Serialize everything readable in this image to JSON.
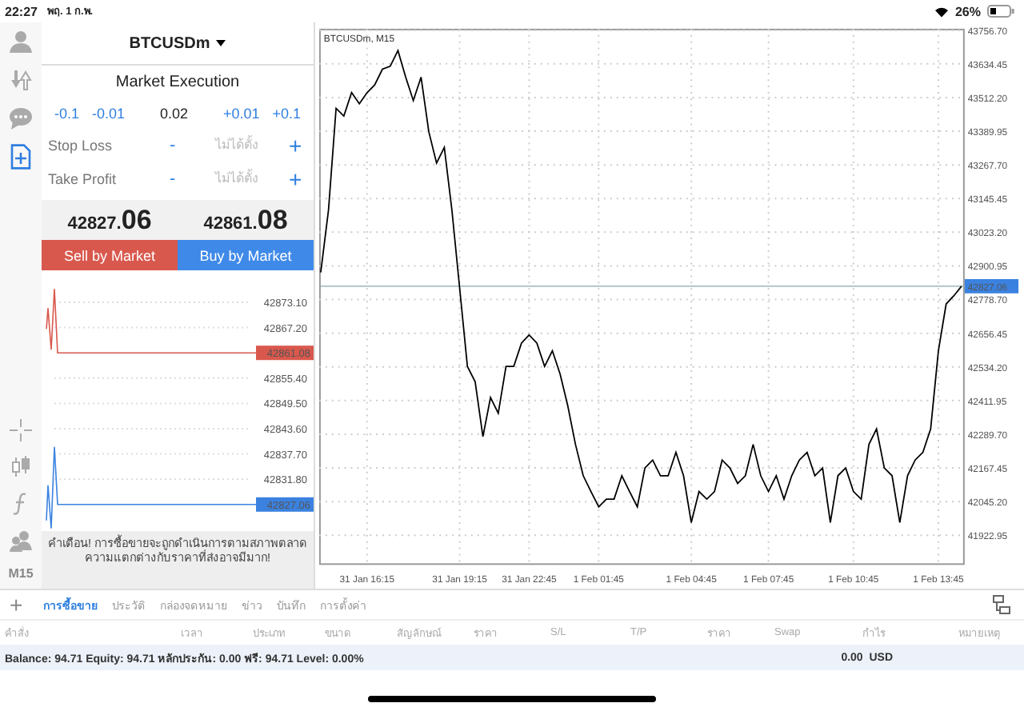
{
  "status_bar": {
    "time": "22:27",
    "date": "พฤ. 1 ก.พ.",
    "battery": "26%"
  },
  "toolbar": {
    "top": [
      {
        "kind": "account",
        "selected": false
      },
      {
        "kind": "trade",
        "selected": false
      },
      {
        "kind": "chat",
        "selected": false
      },
      {
        "kind": "new-order",
        "selected": true
      }
    ],
    "bottom": [
      {
        "kind": "crosshair",
        "selected": false
      },
      {
        "kind": "candles",
        "selected": false
      },
      {
        "kind": "function",
        "selected": false
      },
      {
        "kind": "people",
        "selected": false
      }
    ],
    "timeframe": "M15"
  },
  "order": {
    "symbol": "BTCUSDm",
    "mode": "Market Execution",
    "volume_steps": [
      "-0.1",
      "-0.01",
      "+0.01",
      "+0.1"
    ],
    "volume": "0.02",
    "levels": [
      {
        "label": "Stop Loss",
        "minus": "-",
        "placeholder": "ไม่ได้ตั้ง",
        "plus": "+"
      },
      {
        "label": "Take Profit",
        "minus": "-",
        "placeholder": "ไม่ได้ตั้ง",
        "plus": "+"
      }
    ],
    "bid": {
      "main": "42827.",
      "pips": "06"
    },
    "ask": {
      "main": "42861.",
      "pips": "08"
    },
    "sell_button": "Sell by Market",
    "buy_button": "Buy by Market",
    "tick_chart": {
      "rows": [
        {
          "kind": "tick",
          "label": "42873.10"
        },
        {
          "kind": "tick",
          "label": "42867.20"
        },
        {
          "kind": "ask",
          "label": "42861.08"
        },
        {
          "kind": "tick",
          "label": "42855.40"
        },
        {
          "kind": "tick",
          "label": "42849.50"
        },
        {
          "kind": "tick",
          "label": "42843.60"
        },
        {
          "kind": "tick",
          "label": "42837.70"
        },
        {
          "kind": "tick",
          "label": "42831.80"
        },
        {
          "kind": "bid",
          "label": "42827.06"
        }
      ]
    },
    "warning": "คำเตือน! การซื้อขายจะถูกดำเนินการตามสภาพตลาด ความแตกต่างกับราคาที่ส่งอาจมีมาก!"
  },
  "chart": {
    "chart_data": {
      "type": "line",
      "title": "BTCUSDm, M15",
      "categories": [
        null,
        null,
        null,
        null,
        null,
        null,
        "31 Jan 16:15",
        null,
        null,
        null,
        null,
        null,
        null,
        null,
        null,
        null,
        null,
        null,
        "31 Jan 19:15",
        null,
        null,
        null,
        null,
        null,
        null,
        null,
        null,
        "31 Jan 22:45",
        null,
        null,
        null,
        null,
        null,
        null,
        null,
        null,
        "1 Feb 01:45",
        null,
        null,
        null,
        null,
        null,
        null,
        null,
        null,
        null,
        null,
        null,
        "1 Feb 04:45",
        null,
        null,
        null,
        null,
        null,
        null,
        null,
        null,
        null,
        "1 Feb 07:45",
        null,
        null,
        null,
        null,
        null,
        null,
        null,
        null,
        null,
        null,
        "1 Feb 10:45",
        null,
        null,
        null,
        null,
        null,
        null,
        null,
        null,
        null,
        null,
        "1 Feb 13:45",
        null,
        null,
        null
      ],
      "series": [
        {
          "color": "#000000",
          "values": [
            42877,
            43104,
            43473,
            43445,
            43530,
            43490,
            43530,
            43558,
            43615,
            43626,
            43683,
            43586,
            43501,
            43586,
            43388,
            43274,
            43331,
            43104,
            42820,
            42536,
            42480,
            42281,
            42423,
            42366,
            42536,
            42536,
            42621,
            42650,
            42621,
            42536,
            42593,
            42508,
            42394,
            42253,
            42139,
            42082,
            42026,
            42054,
            42054,
            42139,
            42082,
            42026,
            42167,
            42196,
            42139,
            42139,
            42224,
            42139,
            41969,
            42082,
            42054,
            42082,
            42196,
            42167,
            42111,
            42139,
            42253,
            42139,
            42082,
            42139,
            42054,
            42139,
            42196,
            42224,
            42139,
            42167,
            41969,
            42139,
            42167,
            42082,
            42054,
            42253,
            42309,
            42167,
            42139,
            41969,
            42139,
            42196,
            42224,
            42309,
            42593,
            42763,
            42792,
            42827
          ]
        }
      ],
      "ylim": [
        41821,
        43762
      ],
      "grid": true,
      "yticks": [
        {
          "value": 43756.7,
          "label": "43756.70"
        },
        {
          "value": 43634.45,
          "label": "43634.45"
        },
        {
          "value": 43512.2,
          "label": "43512.20"
        },
        {
          "value": 43389.95,
          "label": "43389.95"
        },
        {
          "value": 43267.7,
          "label": "43267.70"
        },
        {
          "value": 43145.45,
          "label": "43145.45"
        },
        {
          "value": 43023.2,
          "label": "43023.20"
        },
        {
          "value": 42900.95,
          "label": "42900.95"
        },
        {
          "value": 42778.7,
          "label": "42778.70"
        },
        {
          "value": 42656.45,
          "label": "42656.45"
        },
        {
          "value": 42534.2,
          "label": "42534.20"
        },
        {
          "value": 42411.95,
          "label": "42411.95"
        },
        {
          "value": 42289.7,
          "label": "42289.70"
        },
        {
          "value": 42167.45,
          "label": "42167.45"
        },
        {
          "value": 42045.2,
          "label": "42045.20"
        },
        {
          "value": 41922.95,
          "label": "41922.95"
        }
      ],
      "ref_lines": [
        {
          "axis": "y",
          "value": 42827.06,
          "label": "42827.06"
        }
      ]
    }
  },
  "add_button": "+",
  "bottom_tabs": [
    {
      "label": "การซื้อขาย",
      "selected": true
    },
    {
      "label": "ประวัติ",
      "selected": false
    },
    {
      "label": "กล่องจดหมาย",
      "selected": false
    },
    {
      "label": "ข่าว",
      "selected": false
    },
    {
      "label": "บันทึก",
      "selected": false
    },
    {
      "label": "การตั้งค่า",
      "selected": false
    }
  ],
  "table": {
    "columns": [
      "คำสั่ง",
      "เวลา",
      "ประเภท",
      "ขนาด",
      "สัญลักษณ์",
      "ราคา",
      "S/L",
      "T/P",
      "ราคา",
      "Swap",
      "กำไร",
      "หมายเหตุ"
    ]
  },
  "summary": {
    "text": "Balance: 94.71 Equity: 94.71 หลักประกัน: 0.00 ฟรี: 94.71 Level: 0.00%",
    "profit": "0.00  USD"
  }
}
